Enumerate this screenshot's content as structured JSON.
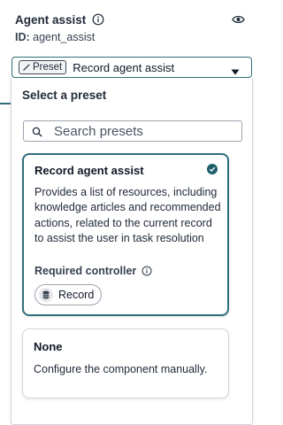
{
  "header": {
    "title": "Agent assist",
    "id_label": "ID:",
    "id_value": "agent_assist"
  },
  "preset_select": {
    "tag_label": "Preset",
    "value": "Record agent assist"
  },
  "dropdown": {
    "title": "Select a preset",
    "search": {
      "placeholder": "Search presets",
      "value": ""
    },
    "presets": [
      {
        "title": "Record agent assist",
        "description": "Provides a list of resources, including knowledge articles and recommended actions, related to the current record to assist the user in task resolution",
        "required_label": "Required controller",
        "controller": "Record",
        "selected": true
      },
      {
        "title": "None",
        "description": "Configure the component manually.",
        "selected": false
      }
    ]
  },
  "colors": {
    "accent": "#2f6f7a",
    "text": "#1f2937",
    "border": "#d1d5db"
  }
}
